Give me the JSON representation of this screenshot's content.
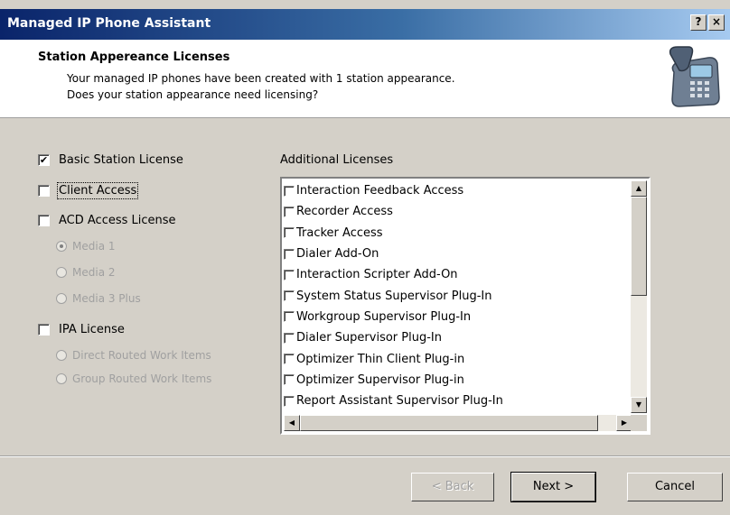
{
  "window": {
    "title": "Managed IP Phone Assistant",
    "help_button": "?",
    "close_button": "×"
  },
  "header": {
    "title": "Station Appereance Licenses",
    "line1": "Your managed IP phones have been created with 1 station appearance.",
    "line2": "Does your station appearance need licensing?"
  },
  "licenses": {
    "basic_station": {
      "label": "Basic Station License",
      "checked": true,
      "check_mark": "✔"
    },
    "client_access": {
      "label": "Client Access",
      "checked": false
    },
    "acd_access": {
      "label": "ACD Access License",
      "checked": false
    },
    "acd_media": [
      {
        "label": "Media 1",
        "selected": true
      },
      {
        "label": "Media 2",
        "selected": false
      },
      {
        "label": "Media 3 Plus",
        "selected": false
      }
    ],
    "ipa": {
      "label": "IPA License",
      "checked": false
    },
    "ipa_options": [
      {
        "label": "Direct Routed Work Items",
        "selected": false
      },
      {
        "label": "Group Routed Work Items",
        "selected": false
      }
    ]
  },
  "additional": {
    "label": "Additional Licenses",
    "items": [
      "Interaction Feedback Access",
      "Recorder Access",
      "Tracker Access",
      "Dialer Add-On",
      "Interaction Scripter Add-On",
      "System Status Supervisor Plug-In",
      "Workgroup Supervisor Plug-In",
      "Dialer Supervisor Plug-In",
      "Optimizer Thin Client Plug-in",
      "Optimizer Supervisor Plug-in",
      "Report Assistant Supervisor Plug-In"
    ]
  },
  "buttons": {
    "back": "< Back",
    "next": "Next >",
    "cancel": "Cancel"
  },
  "colors": {
    "title_start": "#0a246a",
    "title_end": "#a6caf0",
    "dialog_bg": "#d4d0c8"
  }
}
